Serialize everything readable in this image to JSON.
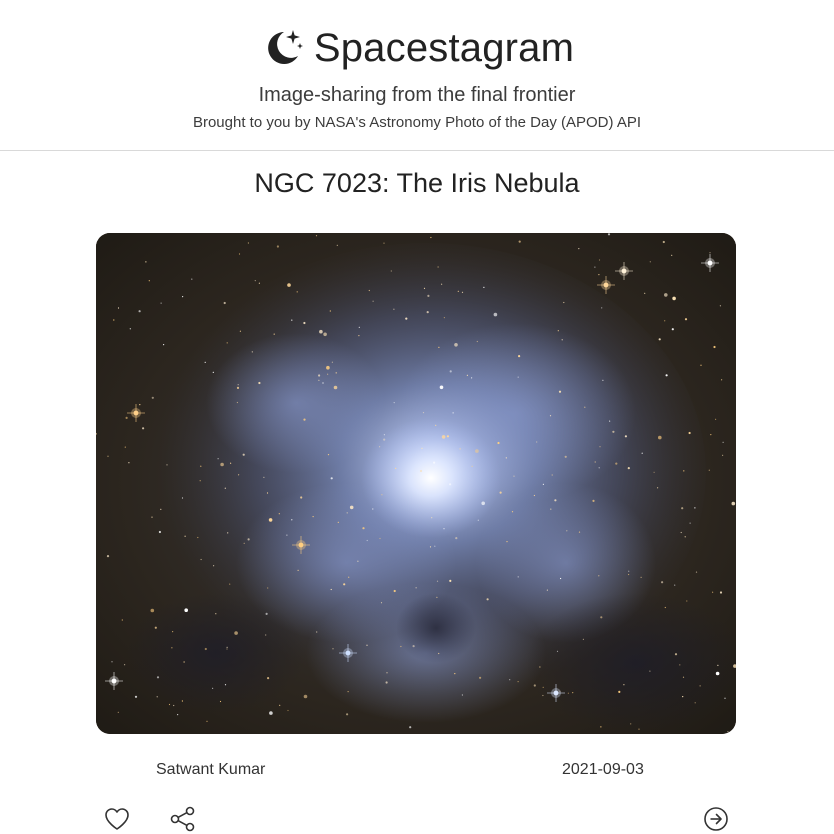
{
  "header": {
    "brand_name": "Spacestagram",
    "brand_icon": "moon-stars-icon",
    "tagline": "Image-sharing from the final frontier",
    "subtagline": "Brought to you by NASA's Astronomy Photo of the Day (APOD) API"
  },
  "post": {
    "title": "NGC 7023: The Iris Nebula",
    "image_subject": "Iris Nebula astrophotograph",
    "author": "Satwant Kumar",
    "date": "2021-09-03",
    "actions": {
      "like_icon": "heart-icon",
      "share_icon": "share-icon",
      "next_icon": "arrow-right-circle-icon"
    }
  }
}
